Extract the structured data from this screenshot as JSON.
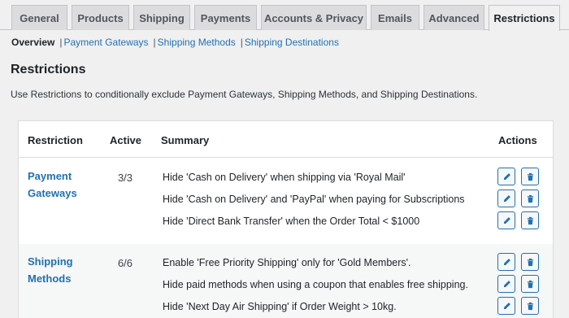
{
  "tabs": [
    "General",
    "Products",
    "Shipping",
    "Payments",
    "Accounts & Privacy",
    "Emails",
    "Advanced",
    "Restrictions"
  ],
  "subnav": {
    "current": "Overview",
    "links": [
      "Payment Gateways",
      "Shipping Methods",
      "Shipping Destinations"
    ]
  },
  "page": {
    "title": "Restrictions",
    "description": "Use Restrictions to conditionally exclude Payment Gateways, Shipping Methods, and Shipping Destinations."
  },
  "table": {
    "headers": {
      "restriction": "Restriction",
      "active": "Active",
      "summary": "Summary",
      "actions": "Actions"
    },
    "groups": [
      {
        "name": "Payment Gateways",
        "active": "3/3",
        "rules": [
          "Hide 'Cash on Delivery' when shipping via 'Royal Mail'",
          "Hide 'Cash on Delivery' and 'PayPal' when paying for Subscriptions",
          "Hide 'Direct Bank Transfer' when the Order Total < $1000"
        ]
      },
      {
        "name": "Shipping Methods",
        "active": "6/6",
        "rules": [
          "Enable 'Free Priority Shipping' only for 'Gold Members'.",
          "Hide paid methods when using a coupon that enables free shipping.",
          "Hide 'Next Day Air Shipping' if Order Weight > 10kg."
        ]
      }
    ]
  },
  "icons": {
    "edit": "pencil-icon",
    "delete": "trash-icon"
  },
  "colors": {
    "link": "#2271b1",
    "background": "#f0f0f1",
    "tab_inactive": "#dcdcde"
  }
}
